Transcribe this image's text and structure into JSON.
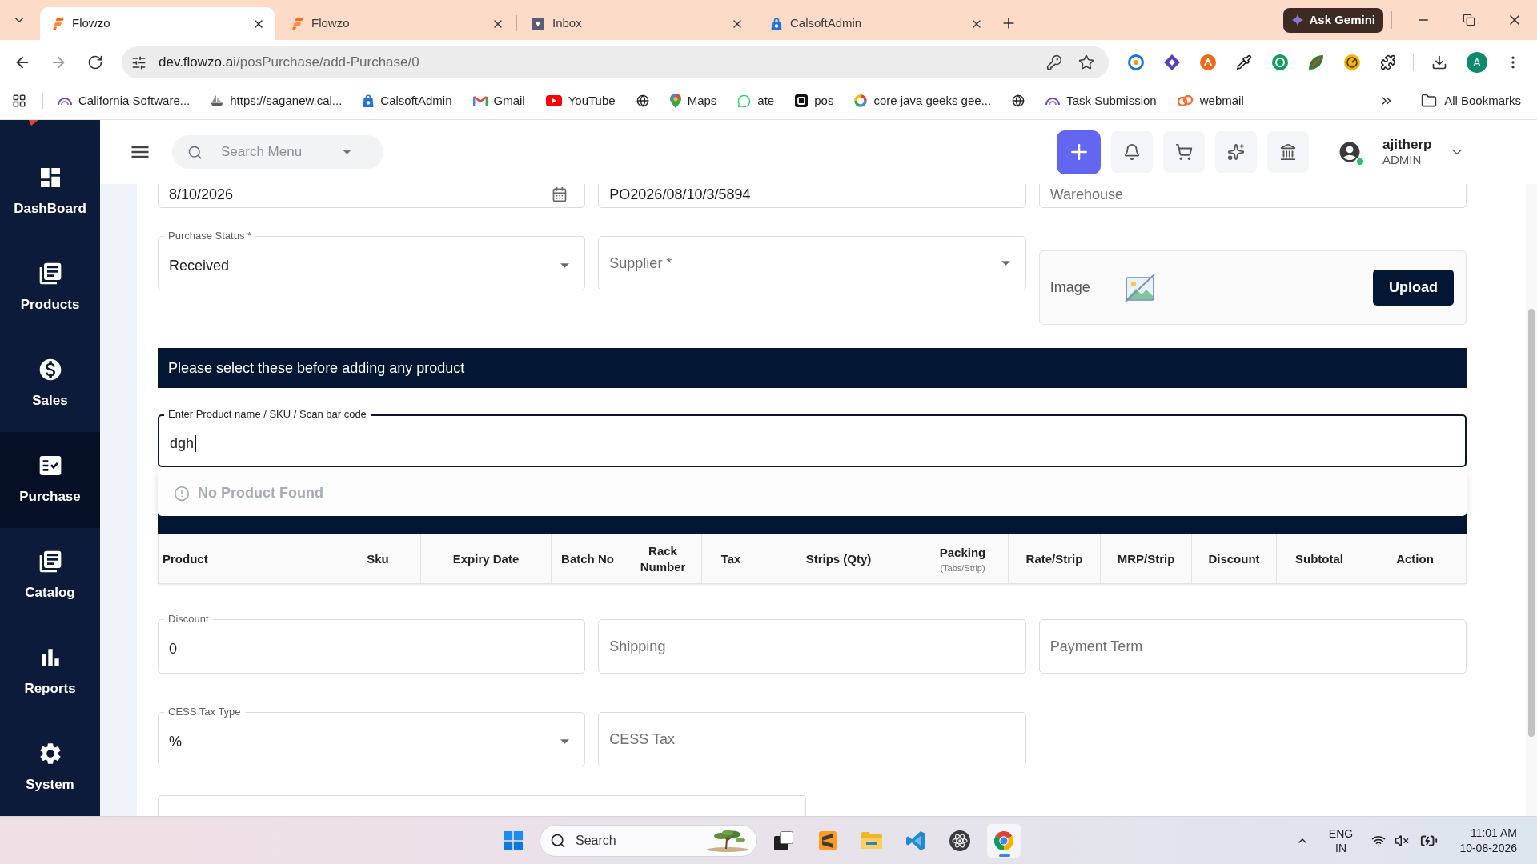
{
  "browser": {
    "tabs": [
      {
        "title": "Flowzo",
        "selected": true
      },
      {
        "title": "Flowzo",
        "selected": false
      },
      {
        "title": "Inbox",
        "selected": false
      },
      {
        "title": "CalsoftAdmin",
        "selected": false
      }
    ],
    "gemini_button": "Ask Gemini",
    "address": {
      "domain": "dev.flowzo.ai",
      "path": "/posPurchase/add-Purchase/0"
    },
    "profile_initial": "A",
    "bookmarks": [
      {
        "kind": "link",
        "label": "California Software..."
      },
      {
        "kind": "link",
        "label": "https://saganew.cal..."
      },
      {
        "kind": "link",
        "label": "CalsoftAdmin"
      },
      {
        "kind": "link",
        "label": "Gmail"
      },
      {
        "kind": "link",
        "label": "YouTube"
      },
      {
        "kind": "icon"
      },
      {
        "kind": "link",
        "label": "Maps"
      },
      {
        "kind": "link",
        "label": "ate"
      },
      {
        "kind": "link",
        "label": "pos"
      },
      {
        "kind": "link",
        "label": "core java geeks gee..."
      },
      {
        "kind": "icon"
      },
      {
        "kind": "link",
        "label": "Task Submission"
      },
      {
        "kind": "link",
        "label": "webmail"
      }
    ],
    "all_bookmarks": "All Bookmarks"
  },
  "sidebar": {
    "items": [
      {
        "label": "DashBoard",
        "selected": false
      },
      {
        "label": "Products",
        "selected": false
      },
      {
        "label": "Sales",
        "selected": false
      },
      {
        "label": "Purchase",
        "selected": true
      },
      {
        "label": "Catalog",
        "selected": false
      },
      {
        "label": "Reports",
        "selected": false
      },
      {
        "label": "System",
        "selected": false
      }
    ]
  },
  "header": {
    "search": {
      "placeholder": "Search Menu"
    },
    "user": {
      "name": "ajitherp",
      "role": "ADMIN",
      "online": true
    }
  },
  "form": {
    "top_row": [
      {
        "kind": "date",
        "value": "8/10/2026"
      },
      {
        "kind": "text",
        "value": "PO2026/08/10/3/5894"
      },
      {
        "kind": "text",
        "placeholder": "Warehouse"
      }
    ],
    "status_row": [
      {
        "kind": "select",
        "label": "Purchase Status *",
        "value": "Received"
      },
      {
        "kind": "select",
        "placeholder": "Supplier *"
      }
    ],
    "image_upload": {
      "label": "Image",
      "button": "Upload"
    },
    "notice": "Please select these before adding any product",
    "product_search": {
      "kind": "text",
      "label": "Enter Product name / SKU / Scan bar code",
      "value": "dgh",
      "focused": true,
      "results_message": "No Product Found"
    },
    "items_table": {
      "columns": [
        {
          "label": "Product"
        },
        {
          "label": "Sku"
        },
        {
          "label": "Expiry Date"
        },
        {
          "label": "Batch No"
        },
        {
          "label": "Rack Number"
        },
        {
          "label": "Tax"
        },
        {
          "label": "Strips (Qty)"
        },
        {
          "label": "Packing",
          "note": "(Tabs/Strip)"
        },
        {
          "label": "Rate/Strip"
        },
        {
          "label": "MRP/Strip"
        },
        {
          "label": "Discount"
        },
        {
          "label": "Subtotal"
        },
        {
          "label": "Action"
        }
      ]
    },
    "totals_row": [
      {
        "kind": "text",
        "label": "Discount",
        "value": "0"
      },
      {
        "kind": "text",
        "placeholder": "Shipping"
      },
      {
        "kind": "text",
        "placeholder": "Payment Term"
      }
    ],
    "cess_row": [
      {
        "kind": "select",
        "label": "CESS Tax Type",
        "value": "%"
      },
      {
        "kind": "text",
        "placeholder": "CESS Tax"
      }
    ],
    "bottom_row": [
      {
        "kind": "text"
      }
    ]
  },
  "taskbar": {
    "search": {
      "placeholder": "Search"
    },
    "apps": [
      {
        "selected": false
      },
      {
        "selected": false
      },
      {
        "selected": false
      },
      {
        "selected": false
      },
      {
        "selected": false
      },
      {
        "selected": true
      }
    ],
    "language": "ENG",
    "region": "IN",
    "time": "11:01 AM",
    "date": "10-08-2026"
  }
}
